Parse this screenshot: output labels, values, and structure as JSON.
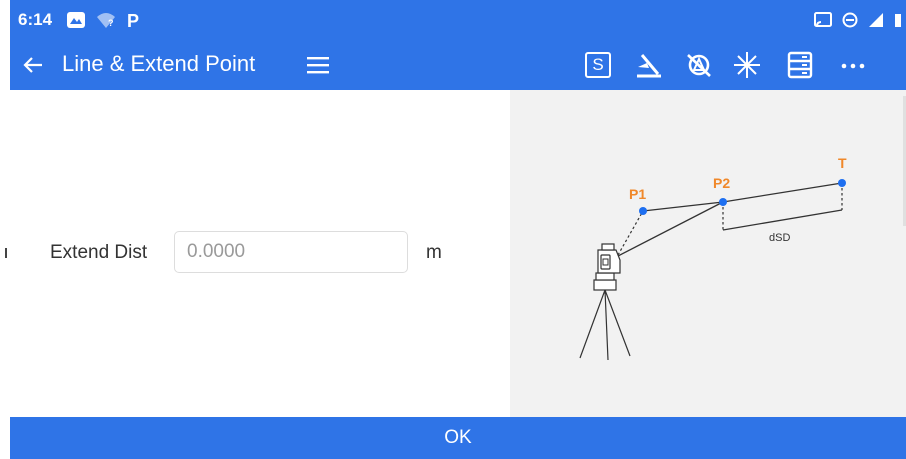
{
  "status_bar": {
    "time": "6:14",
    "left_icons": [
      "photos-icon",
      "wifi-question-icon",
      "parking-p-icon"
    ],
    "right_icons": [
      "cast-icon",
      "do-not-disturb-icon",
      "signal-icon",
      "battery-icon"
    ]
  },
  "app_bar": {
    "title": "Line & Extend Point",
    "s_label": "S",
    "tools": [
      "back-arrow-icon",
      "hamburger-menu-icon",
      "s-button",
      "level-bubble-icon",
      "prism-off-icon",
      "laser-star-icon",
      "list-panel-icon",
      "more-icon"
    ]
  },
  "form": {
    "label": "Extend Dist",
    "placeholder": "0.0000",
    "value": "",
    "unit": "m"
  },
  "diagram": {
    "p1_label": "P1",
    "p2_label": "P2",
    "t_label": "T",
    "dsd_label": "dSD",
    "point_color": "#1e6ff0",
    "label_color": "#f0882a"
  },
  "ok_label": "OK",
  "colors": {
    "primary": "#2f74e7",
    "pane_gray": "#f2f2f2"
  }
}
